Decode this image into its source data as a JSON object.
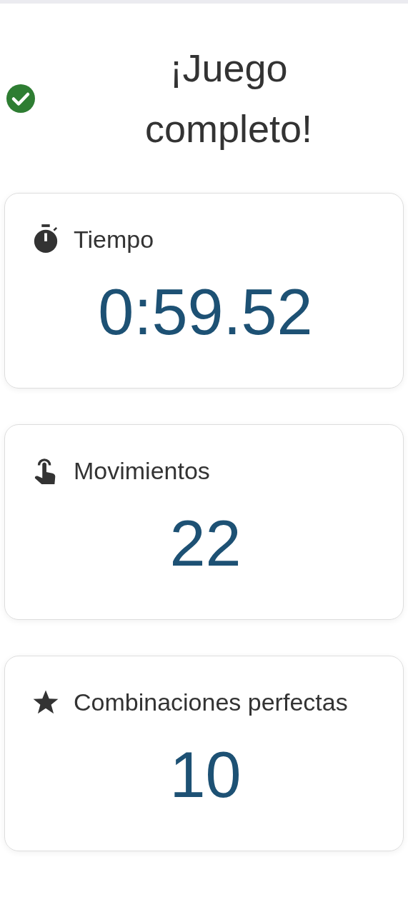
{
  "header": {
    "title": "¡Juego completo!"
  },
  "stats": [
    {
      "kind": "time",
      "label": "Tiempo",
      "value": "0:59.52"
    },
    {
      "kind": "moves",
      "label": "Movimientos",
      "value": "22"
    },
    {
      "kind": "perfect",
      "label": "Combinaciones perfectas",
      "value": "10"
    }
  ]
}
